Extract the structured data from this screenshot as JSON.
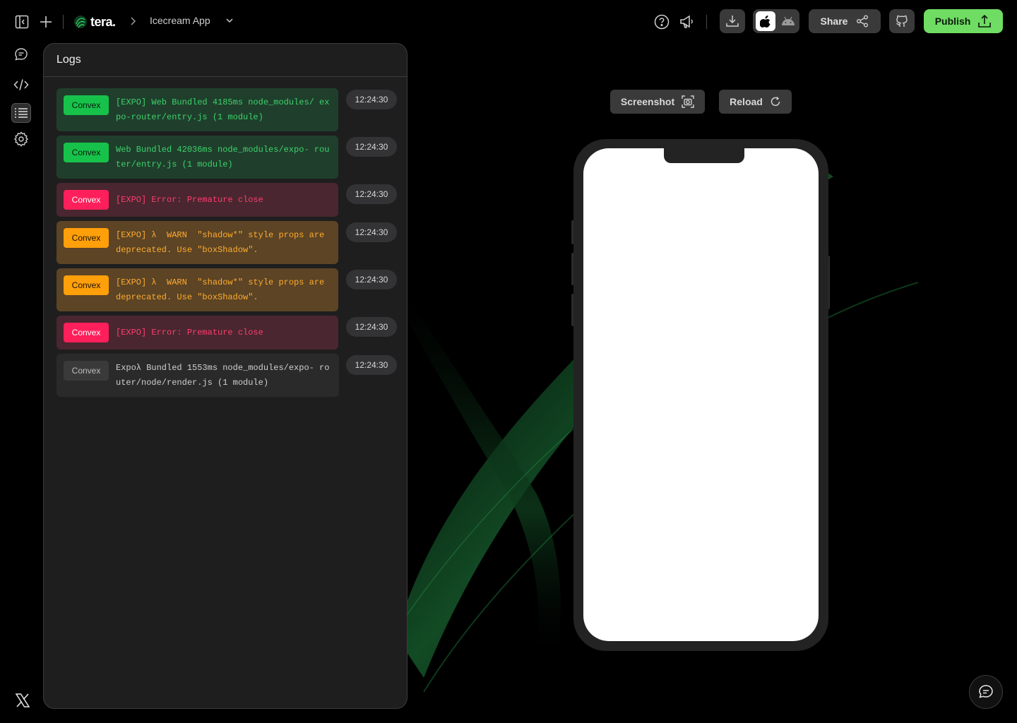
{
  "brand": {
    "name": "tera."
  },
  "project": {
    "name": "Icecream App"
  },
  "toolbar": {
    "share_label": "Share",
    "publish_label": "Publish"
  },
  "logs": {
    "title": "Logs",
    "entries": [
      {
        "source": "Convex",
        "level": "success",
        "message": "[EXPO] Web Bundled 4185ms node_modules/ expo-router/entry.js (1 module)",
        "time": "12:24:30"
      },
      {
        "source": "Convex",
        "level": "success",
        "message": "Web Bundled 42036ms node_modules/expo- router/entry.js (1 module)",
        "time": "12:24:30"
      },
      {
        "source": "Convex",
        "level": "error",
        "message": "[EXPO] Error: Premature close",
        "time": "12:24:30"
      },
      {
        "source": "Convex",
        "level": "warn",
        "message": "[EXPO] λ  WARN  \"shadow*\" style props are deprecated. Use \"boxShadow\".",
        "time": "12:24:30"
      },
      {
        "source": "Convex",
        "level": "warn",
        "message": "[EXPO] λ  WARN  \"shadow*\" style props are deprecated. Use \"boxShadow\".",
        "time": "12:24:30"
      },
      {
        "source": "Convex",
        "level": "error",
        "message": "[EXPO] Error: Premature close",
        "time": "12:24:30"
      },
      {
        "source": "Convex",
        "level": "info",
        "message": "Expoλ Bundled 1553ms node_modules/expo- router/node/render.js (1 module)",
        "time": "12:24:30"
      }
    ]
  },
  "preview": {
    "screenshot_label": "Screenshot",
    "reload_label": "Reload"
  },
  "colors": {
    "publish": "#6fdc63",
    "success": "#17c24a",
    "error": "#ff1f5a",
    "warn": "#ff9f0a",
    "panel": "#1e1e1f"
  },
  "icons": {
    "rail": [
      "chat-icon",
      "code-icon",
      "list-icon",
      "gear-icon"
    ],
    "topbar": [
      "sidebar-toggle-icon",
      "plus-icon",
      "help-icon",
      "megaphone-icon",
      "download-icon",
      "apple-icon",
      "android-icon",
      "share-icon",
      "github-icon",
      "upload-icon"
    ]
  }
}
